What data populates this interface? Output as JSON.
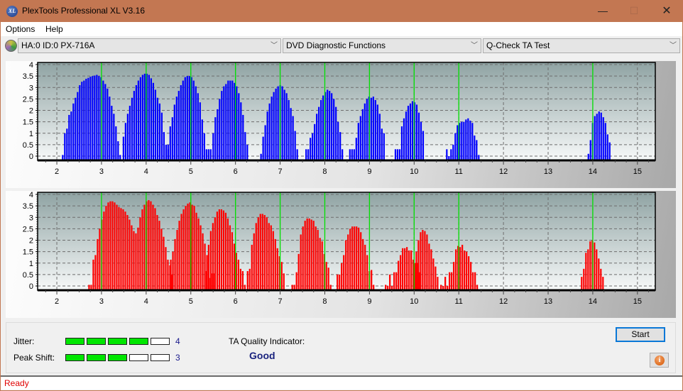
{
  "window": {
    "title": "PlexTools Professional XL V3.16",
    "icon": "plextools-xl-logo",
    "icon_text": "XL",
    "controls": {
      "minimize": "—",
      "maximize": "☐",
      "close": "✕"
    }
  },
  "menu": [
    "Options",
    "Help"
  ],
  "toolbar": {
    "drive": "HA:0 ID:0  PX-716A",
    "function": "DVD Diagnostic Functions",
    "test": "Q-Check TA Test",
    "chevron": "﹀"
  },
  "colors": {
    "jitter_series": "#0000ff",
    "peak_shift_series": "#ff0000",
    "marker_lines": "#00e000",
    "meter_on": "#00e600",
    "status_text": "#e00000"
  },
  "chart_data": [
    {
      "type": "bar",
      "title": "",
      "xlabel": "",
      "ylabel": "",
      "xlim": [
        1.57,
        15.4
      ],
      "ylim": [
        0,
        4.15
      ],
      "xticks": [
        2,
        3,
        4,
        5,
        6,
        7,
        8,
        9,
        10,
        11,
        12,
        13,
        14,
        15
      ],
      "yticks": [
        0,
        0.5,
        1,
        1.5,
        2,
        2.5,
        3,
        3.5,
        4
      ],
      "ytick_labels": [
        "0",
        "0.5",
        "1",
        "1.5",
        "2",
        "2.5",
        "3",
        "3.5",
        "4"
      ],
      "grid": true,
      "marker_lines": [
        3,
        4,
        5,
        6,
        7,
        8,
        9,
        10,
        11,
        14
      ],
      "color": "#0000ff",
      "bar_step": 0.0477,
      "clusters": [
        {
          "start": 2.13,
          "values": [
            0.05,
            1.0,
            1.2,
            1.8,
            1.95,
            2.3,
            2.55,
            2.8,
            3.1,
            3.25,
            3.3,
            3.38,
            3.42,
            3.47,
            3.5,
            3.52,
            3.55,
            3.5,
            3.45,
            3.3,
            3.15,
            2.95,
            2.6,
            2.2,
            1.85,
            1.3,
            0.65,
            0.05
          ]
        },
        {
          "start": 3.49,
          "values": [
            0.85,
            1.45,
            1.85,
            2.2,
            2.55,
            2.85,
            3.1,
            3.3,
            3.45,
            3.55,
            3.6,
            3.6,
            3.55,
            3.4,
            3.2,
            2.9,
            2.55,
            2.3,
            1.9,
            1.05,
            0.5,
            0.3
          ]
        },
        {
          "start": 4.49,
          "values": [
            0.5,
            1.3,
            1.7,
            2.25,
            2.6,
            2.85,
            3.1,
            3.3,
            3.45,
            3.5,
            3.5,
            3.45,
            3.3,
            3.05,
            2.75,
            2.35,
            1.6,
            1.0,
            0.3,
            0.3,
            0.3
          ]
        },
        {
          "start": 5.5,
          "values": [
            1.0,
            1.7,
            2.05,
            2.5,
            2.85,
            3.05,
            3.15,
            3.3,
            3.3,
            3.3,
            3.2,
            3.05,
            2.75,
            2.35,
            1.8,
            1.05,
            0.5
          ]
        },
        {
          "start": 6.57,
          "values": [
            0.1,
            0.85,
            1.35,
            1.95,
            2.3,
            2.6,
            2.8,
            2.95,
            3.05,
            3.1,
            3.05,
            2.9,
            2.75,
            2.45,
            2.1,
            1.75,
            1.1,
            0.3
          ]
        },
        {
          "start": 7.58,
          "values": [
            0.3,
            0.3,
            0.8,
            1.0,
            1.4,
            1.85,
            2.15,
            2.45,
            2.65,
            2.8,
            2.9,
            2.85,
            2.75,
            2.5,
            2.15,
            1.5,
            1.05,
            0.3
          ]
        },
        {
          "start": 8.56,
          "values": [
            0.3,
            0.3,
            0.3,
            0.8,
            1.45,
            1.75,
            2.05,
            2.3,
            2.5,
            2.6,
            2.55,
            2.6,
            2.45,
            2.25,
            1.85,
            1.2,
            1.0
          ]
        },
        {
          "start": 9.58,
          "values": [
            0.3,
            0.3,
            0.3,
            1.3,
            1.65,
            1.95,
            2.2,
            2.3,
            2.4,
            2.35,
            2.25,
            1.9,
            1.5,
            1.1
          ]
        },
        {
          "start": 10.73,
          "values": [
            0.3,
            0.0,
            0.3,
            0.5,
            1.0,
            1.35,
            1.45,
            1.5,
            1.5,
            1.6,
            1.65,
            1.55,
            1.45,
            0.9,
            0.7,
            0.05
          ]
        },
        {
          "start": 13.9,
          "values": [
            0.1,
            0.7,
            1.45,
            1.75,
            1.85,
            1.95,
            1.9,
            1.7,
            1.45,
            0.95,
            0.6
          ]
        }
      ]
    },
    {
      "type": "bar",
      "title": "",
      "xlabel": "",
      "ylabel": "",
      "xlim": [
        1.57,
        15.4
      ],
      "ylim": [
        0,
        4.15
      ],
      "xticks": [
        2,
        3,
        4,
        5,
        6,
        7,
        8,
        9,
        10,
        11,
        12,
        13,
        14,
        15
      ],
      "yticks": [
        0,
        0.5,
        1,
        1.5,
        2,
        2.5,
        3,
        3.5,
        4
      ],
      "ytick_labels": [
        "0",
        "0.5",
        "1",
        "1.5",
        "2",
        "2.5",
        "3",
        "3.5",
        "4"
      ],
      "grid": true,
      "marker_lines": [
        3,
        4,
        5,
        6,
        7,
        8,
        9,
        10,
        11,
        14
      ],
      "color": "#ff0000",
      "bar_step": 0.0477,
      "clusters": [
        {
          "start": 2.72,
          "values": [
            0.05,
            0.05,
            1.15,
            1.35,
            2.05,
            2.5,
            2.9,
            3.25,
            3.5,
            3.65,
            3.7,
            3.7,
            3.65,
            3.55,
            3.45,
            3.4,
            3.35,
            3.25,
            3.1,
            2.9,
            2.65,
            2.4,
            2.3,
            2.55,
            3.0,
            3.35,
            3.55,
            3.7,
            3.75,
            3.7,
            3.55,
            3.4,
            3.1,
            2.85,
            2.5,
            2.15,
            1.7,
            1.15,
            0.9,
            0.5
          ]
        },
        {
          "start": 4.55,
          "values": [
            1.15,
            1.5,
            2.05,
            2.45,
            2.85,
            3.15,
            3.35,
            3.5,
            3.6,
            3.65,
            3.55,
            3.5,
            3.2,
            2.95,
            2.65,
            2.3,
            1.85,
            1.35,
            0.35,
            0.55,
            0.55
          ]
        },
        {
          "start": 5.35,
          "values": [
            0.65,
            1.8,
            2.4,
            2.75,
            3.0,
            3.25,
            3.35,
            3.35,
            3.3,
            3.2,
            2.95,
            2.65,
            2.35,
            1.85,
            1.45,
            1.15,
            0.75,
            0.65,
            0.05
          ]
        },
        {
          "start": 6.27,
          "values": [
            0.65,
            0.75,
            1.8,
            2.3,
            2.75,
            3.0,
            3.15,
            3.15,
            3.1,
            3.0,
            2.75,
            2.65,
            2.4,
            2.05,
            1.65,
            1.3,
            1.05,
            0.55
          ]
        },
        {
          "start": 7.27,
          "values": [
            0.05,
            0.05,
            0.6,
            1.4,
            2.25,
            2.6,
            2.85,
            2.95,
            2.95,
            2.9,
            2.85,
            2.6,
            2.45,
            2.1,
            1.95,
            1.4,
            1.05,
            0.8,
            0.05
          ]
        },
        {
          "start": 8.28,
          "values": [
            0.5,
            0.5,
            1.0,
            1.35,
            2.0,
            2.25,
            2.5,
            2.6,
            2.6,
            2.6,
            2.55,
            2.35,
            2.05,
            1.8,
            1.35,
            0.65,
            0.7,
            0.05
          ]
        },
        {
          "start": 9.36,
          "values": [
            0.05,
            0.0,
            0.5,
            0.0,
            0.6,
            0.6,
            1.1,
            1.35,
            1.65,
            1.65,
            1.7,
            1.55,
            1.55,
            1.15,
            1.0,
            1.0,
            0.6
          ]
        },
        {
          "start": 10.0,
          "values": [
            1.0,
            1.5,
            2.0,
            2.35,
            2.45,
            2.4,
            2.25,
            1.85,
            1.6,
            1.2,
            0.85,
            0.4
          ]
        },
        {
          "start": 10.6,
          "values": [
            0.05,
            0.0,
            0.4,
            0.0,
            0.6,
            0.6,
            1.05,
            1.6,
            1.75,
            1.7,
            1.8,
            1.55,
            1.5,
            1.3,
            1.05,
            0.6,
            0.6,
            0.05
          ]
        },
        {
          "start": 13.75,
          "values": [
            0.4,
            0.75,
            1.45,
            1.6,
            1.95,
            2.0,
            1.9,
            1.6,
            1.2,
            0.75,
            0.4
          ]
        }
      ]
    }
  ],
  "results": {
    "jitter_label": "Jitter:",
    "jitter_value": "4",
    "jitter_level": 4,
    "peak_shift_label": "Peak Shift:",
    "peak_shift_value": "3",
    "peak_shift_level": 3,
    "meter_max": 5,
    "ta_quality_label": "TA Quality Indicator:",
    "ta_quality_value": "Good"
  },
  "buttons": {
    "start": "Start",
    "info_icon": "i"
  },
  "status": "Ready"
}
